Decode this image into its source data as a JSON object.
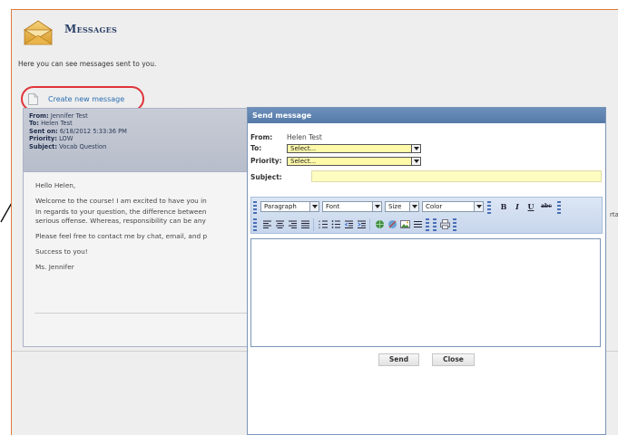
{
  "page": {
    "title": "Messages",
    "intro": "Here you can see messages sent to you.",
    "create_link": "Create new message"
  },
  "message": {
    "from_label": "From:",
    "from": "Jennifer Test",
    "to_label": "To:",
    "to": "Helen Test",
    "sent_label": "Sent on:",
    "sent": "6/18/2012 5:33:36 PM",
    "priority_label": "Priority:",
    "priority": "LOW",
    "subject_label": "Subject:",
    "subject": "Vocab Question",
    "body": [
      "Hello Helen,",
      "Welcome to the course! I am excited to have you in",
      "In regards to your question, the difference between",
      "serious offense. Whereas, responsibility can be any",
      "Please feel free to contact me by chat, email, and p",
      "Success to you!",
      "Ms. Jennifer"
    ],
    "overflow_text": "rta"
  },
  "dialog": {
    "title": "Send message",
    "from_label": "From:",
    "from_value": "Helen Test",
    "to_label": "To:",
    "to_select": "Select...",
    "priority_label": "Priority:",
    "priority_select": "Select...",
    "subject_label": "Subject:",
    "subject_value": "",
    "toolbar": {
      "paragraph": "Paragraph",
      "font": "Font",
      "size": "Size",
      "color": "Color",
      "bold": "B",
      "italic": "I",
      "underline": "U",
      "strike": "abc"
    },
    "send_label": "Send",
    "close_label": "Close"
  },
  "colors": {
    "accent_red": "#e0343a",
    "title_blue": "#557aa8",
    "select_yellow": "#fffaaa"
  }
}
